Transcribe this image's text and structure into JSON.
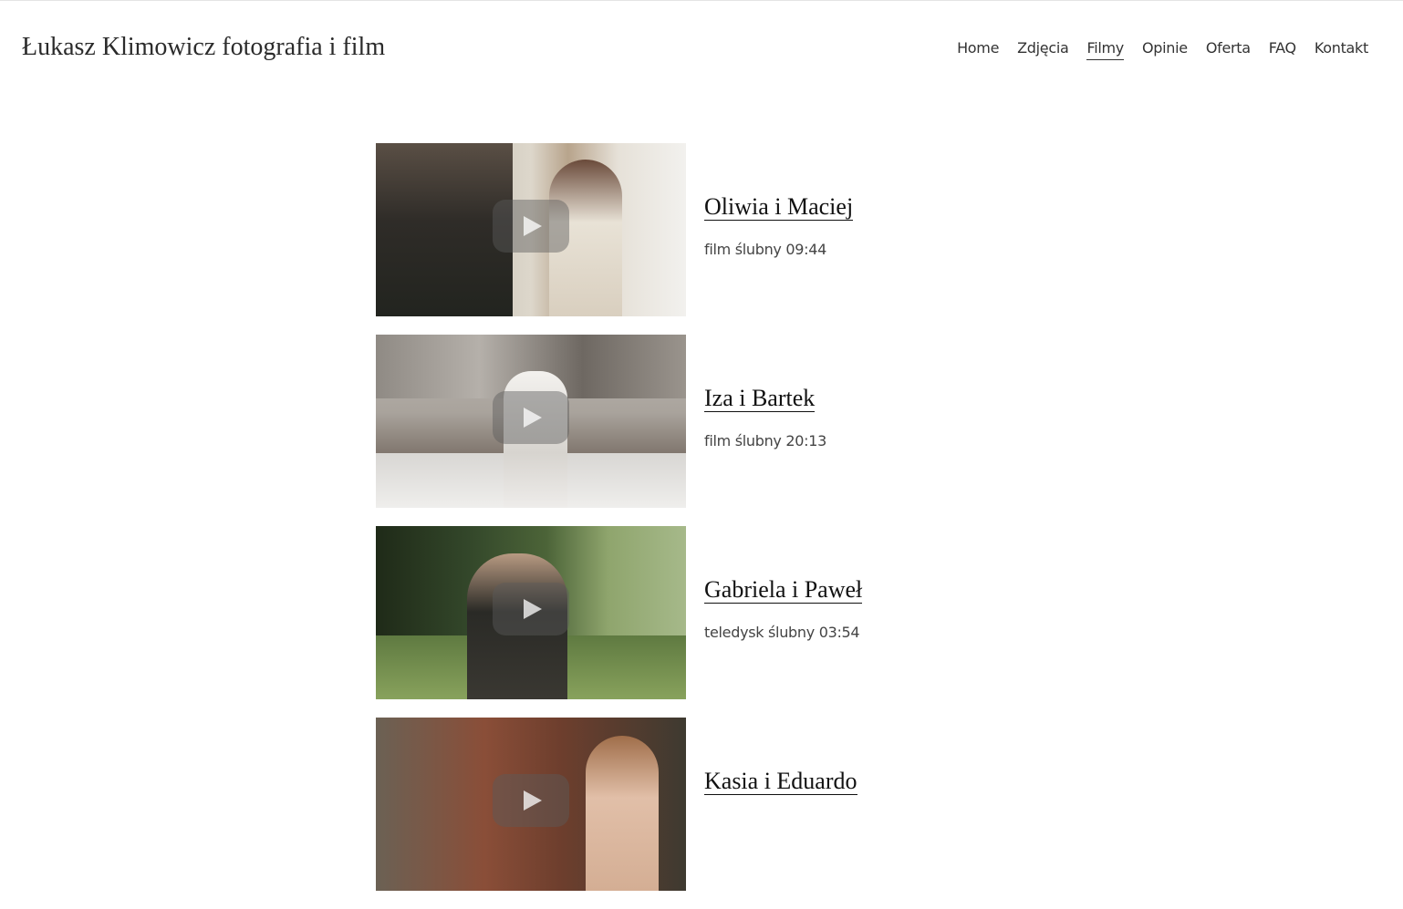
{
  "site": {
    "title": "Łukasz Klimowicz fotografia i film"
  },
  "nav": {
    "items": [
      {
        "label": "Home"
      },
      {
        "label": "Zdjęcia"
      },
      {
        "label": "Filmy"
      },
      {
        "label": "Opinie"
      },
      {
        "label": "Oferta"
      },
      {
        "label": "FAQ"
      },
      {
        "label": "Kontakt"
      }
    ],
    "active": "Filmy"
  },
  "videos": [
    {
      "title": "Oliwia i Maciej",
      "description": "film ślubny 09:44"
    },
    {
      "title": "Iza i Bartek",
      "description": "film ślubny 20:13"
    },
    {
      "title": "Gabriela i Paweł",
      "description": "teledysk ślubny 03:54"
    },
    {
      "title": "Kasia i Eduardo",
      "description": ""
    }
  ],
  "colors": {
    "text": "#222222",
    "rule": "#e4e4e4"
  },
  "icons": {
    "play": "play-icon"
  }
}
